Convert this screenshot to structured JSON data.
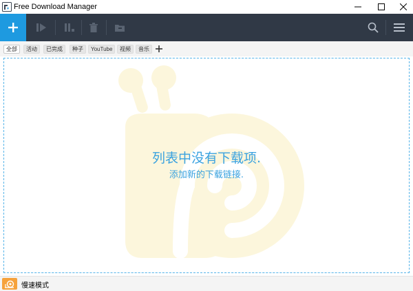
{
  "window": {
    "title": "Free Download Manager"
  },
  "toolbar": {
    "add_icon": "plus-icon",
    "start_icon": "play-icon",
    "pause_icon": "pause-icon",
    "delete_icon": "trash-icon",
    "move_icon": "folder-icon",
    "search_icon": "search-icon",
    "menu_icon": "hamburger-icon",
    "accent_color": "#1e9ae0",
    "background_color": "#303946"
  },
  "tags": [
    {
      "label": "全部",
      "active": true
    },
    {
      "label": "活动",
      "active": false
    },
    {
      "label": "已完成",
      "active": false
    },
    {
      "label": "种子",
      "active": false
    },
    {
      "label": "YouTube",
      "active": false
    },
    {
      "label": "视频",
      "active": false
    },
    {
      "label": "音乐",
      "active": false
    }
  ],
  "empty_state": {
    "title": "列表中没有下载项.",
    "subtitle": "添加新的下载链接.",
    "text_color": "#3aa2df"
  },
  "statusbar": {
    "snail_mode_label": "慢速模式",
    "snail_mode_color": "#f6a23c"
  }
}
